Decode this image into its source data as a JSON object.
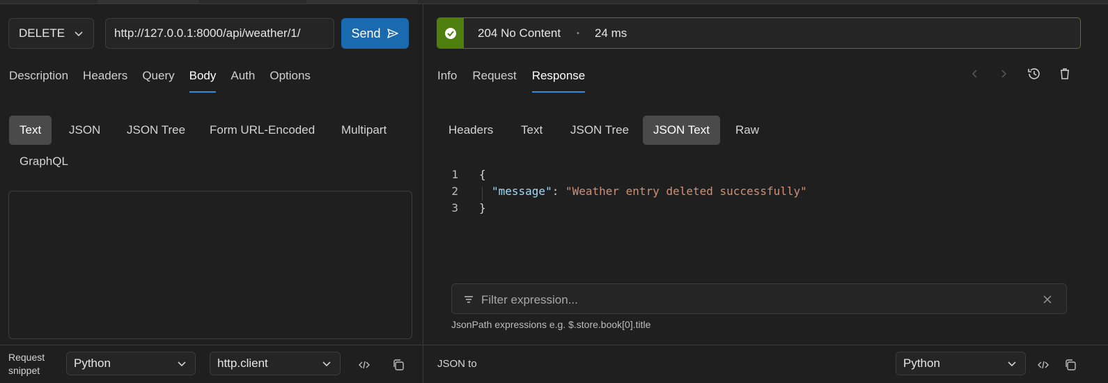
{
  "request": {
    "method": "DELETE",
    "url": "http://127.0.0.1:8000/api/weather/1/",
    "send_label": "Send",
    "tabs": [
      "Description",
      "Headers",
      "Query",
      "Body",
      "Auth",
      "Options"
    ],
    "active_tab": "Body",
    "body_types": [
      "Text",
      "JSON",
      "JSON Tree",
      "Form URL-Encoded",
      "Multipart",
      "GraphQL"
    ],
    "active_body_type": "Text"
  },
  "snippet": {
    "label_line1": "Request",
    "label_line2": "snippet",
    "language": "Python",
    "client": "http.client"
  },
  "response": {
    "status": "204 No Content",
    "separator": "•",
    "time": "24 ms",
    "status_color": "#4e7f0f",
    "tabs": [
      "Info",
      "Request",
      "Response"
    ],
    "active_tab": "Response",
    "view_types": [
      "Headers",
      "Text",
      "JSON Tree",
      "JSON Text",
      "Raw"
    ],
    "active_view": "JSON Text",
    "lines": [
      {
        "num": "1",
        "text": "{"
      },
      {
        "num": "2",
        "key": "\"message\"",
        "colon": ": ",
        "value": "\"Weather entry deleted successfully\""
      },
      {
        "num": "3",
        "text": "}"
      }
    ],
    "filter_placeholder": "Filter expression...",
    "filter_hint": "JsonPath expressions e.g. $.store.book[0].title",
    "convert_label": "JSON to",
    "convert_language": "Python"
  }
}
